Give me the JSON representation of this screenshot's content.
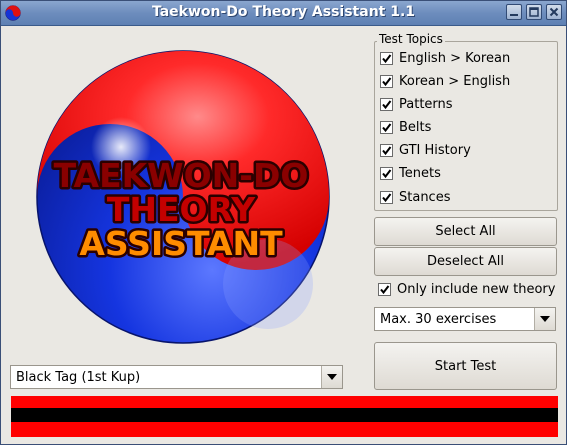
{
  "window": {
    "title": "Taekwon-Do Theory Assistant 1.1",
    "icon": "yin-yang-icon",
    "buttons": [
      "minimize-icon",
      "maximize-icon",
      "close-icon"
    ]
  },
  "logo": {
    "line1": "TAEKWON-DO",
    "line2": "THEORY",
    "line3": "ASSISTANT"
  },
  "topics": {
    "label": "Test Topics",
    "items": [
      {
        "label": "English > Korean",
        "checked": true
      },
      {
        "label": "Korean > English",
        "checked": true
      },
      {
        "label": "Patterns",
        "checked": true
      },
      {
        "label": "Belts",
        "checked": true
      },
      {
        "label": "GTI History",
        "checked": true
      },
      {
        "label": "Tenets",
        "checked": true
      },
      {
        "label": "Stances",
        "checked": true
      }
    ]
  },
  "buttons": {
    "select_all": "Select All",
    "deselect_all": "Deselect All",
    "start_test": "Start Test"
  },
  "only_new": {
    "label": "Only include new theory",
    "checked": true
  },
  "exercises": {
    "selected": "Max. 30 exercises"
  },
  "belt_select": {
    "selected": "Black Tag (1st Kup)"
  },
  "colors": {
    "red": "#ff0000",
    "black": "#000000",
    "blue": "#1533d6",
    "title_bar": "#6d8dbd"
  }
}
